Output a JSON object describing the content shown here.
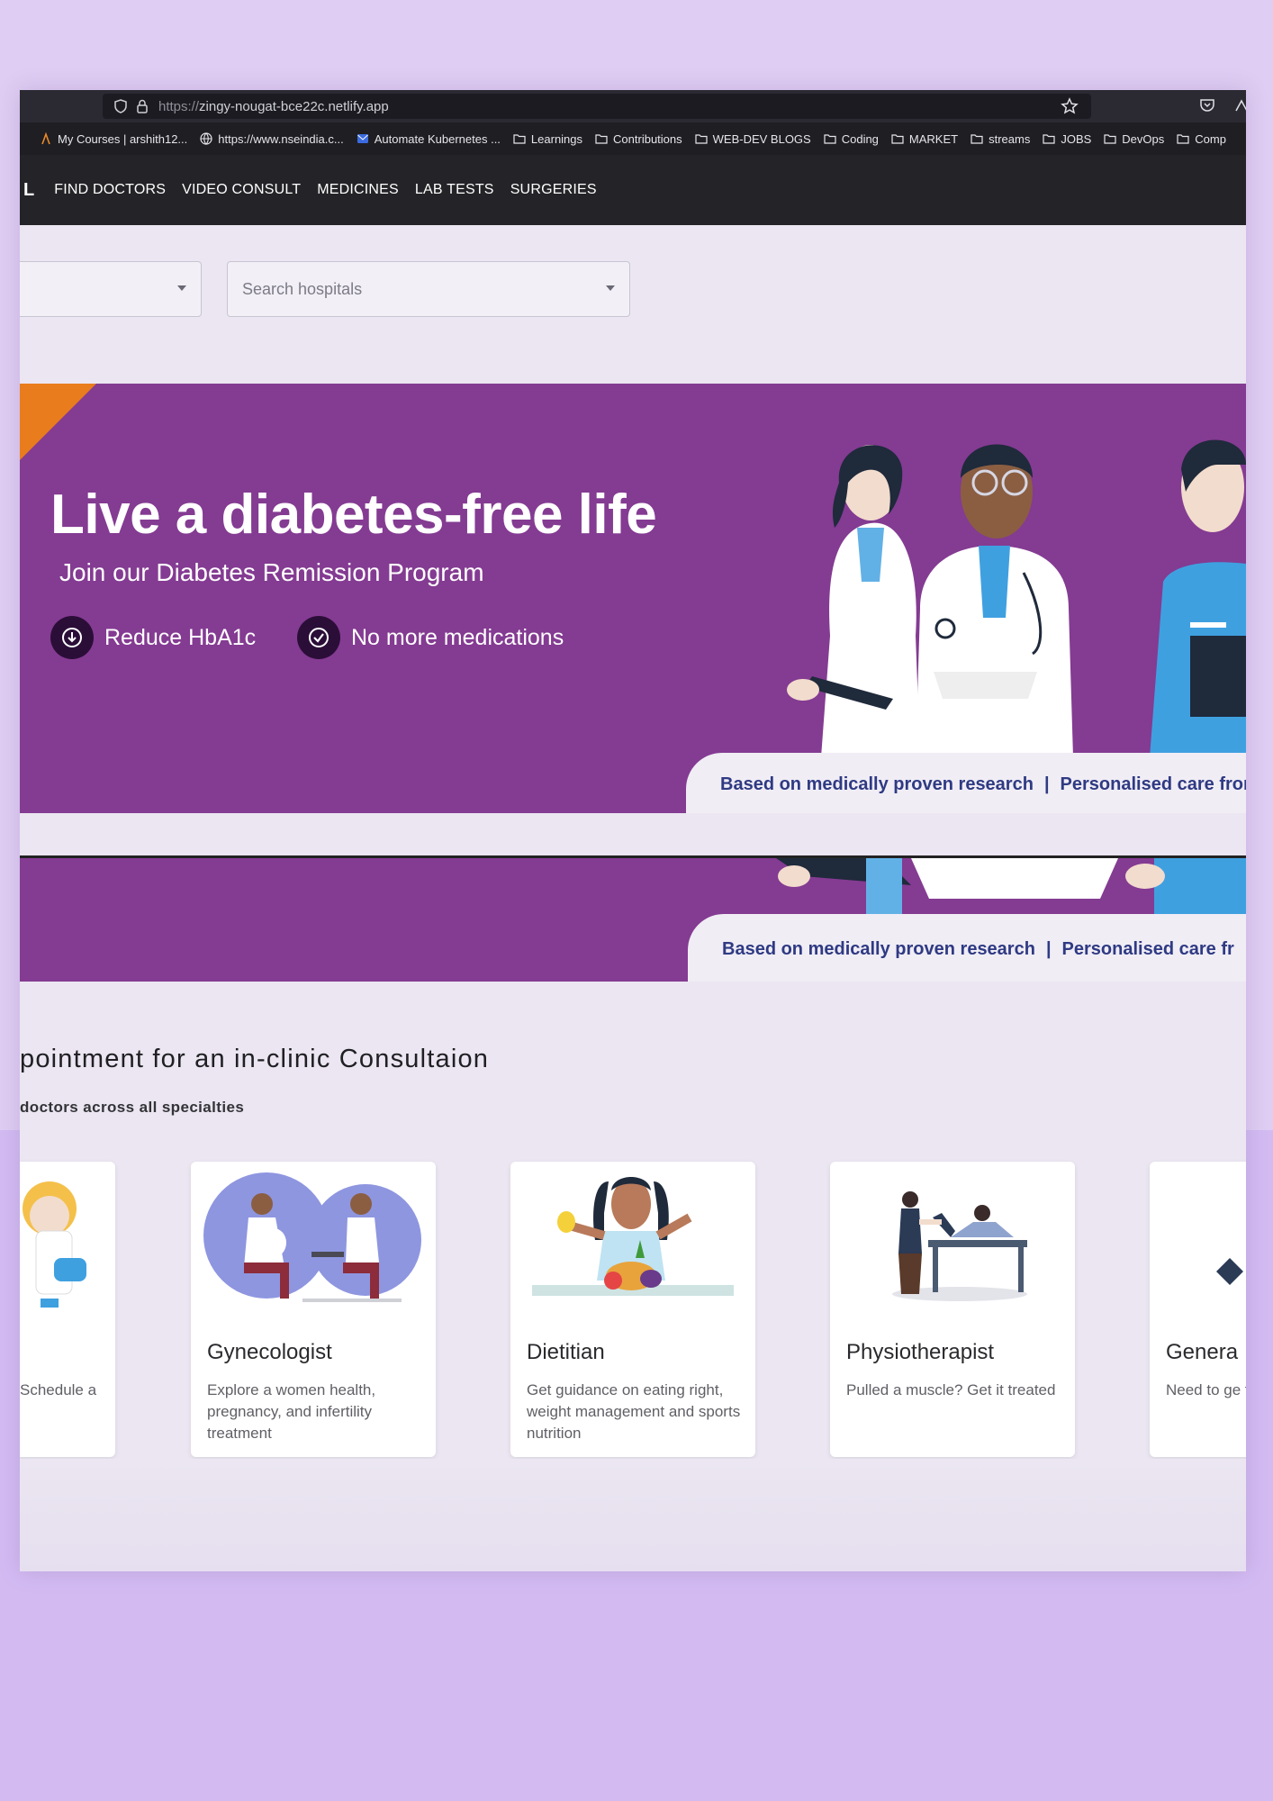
{
  "browser": {
    "url_prefix": "https://",
    "url_host": "zingy-nougat-bce22c.netlify.app",
    "bookmarks": [
      {
        "icon": "person-icon",
        "label": "My Courses | arshith12..."
      },
      {
        "icon": "globe-icon",
        "label": "https://www.nseindia.c..."
      },
      {
        "icon": "mail-icon",
        "label": "Automate Kubernetes ..."
      },
      {
        "icon": "folder-icon",
        "label": "Learnings"
      },
      {
        "icon": "folder-icon",
        "label": "Contributions"
      },
      {
        "icon": "folder-icon",
        "label": "WEB-DEV BLOGS"
      },
      {
        "icon": "folder-icon",
        "label": "Coding"
      },
      {
        "icon": "folder-icon",
        "label": "MARKET"
      },
      {
        "icon": "folder-icon",
        "label": "streams"
      },
      {
        "icon": "folder-icon",
        "label": "JOBS"
      },
      {
        "icon": "folder-icon",
        "label": "DevOps"
      },
      {
        "icon": "folder-icon",
        "label": "Comp"
      }
    ]
  },
  "nav": {
    "logo_fragment": "L",
    "items": [
      "FIND DOCTORS",
      "VIDEO CONSULT",
      "MEDICINES",
      "LAB TESTS",
      "SURGERIES"
    ]
  },
  "search": {
    "location_value": "",
    "hospital_placeholder": "Search hospitals"
  },
  "banner": {
    "title": "Live a diabetes-free life",
    "subtitle": "Join our Diabetes Remission Program",
    "features": [
      "Reduce HbA1c",
      "No more medications"
    ],
    "pill_left": "Based on medically proven research",
    "pill_sep": "|",
    "pill_right": "Personalised care from an",
    "strip_pill_left": "Based on medically proven research",
    "strip_pill_right": "Personalised care fr",
    "colors": {
      "purple": "#843b92",
      "orange": "#e97c1d",
      "navy": "#2f3a83"
    }
  },
  "consult": {
    "title": "pointment for an in-clinic Consultaion",
    "subtitle": "doctors across all specialties",
    "cards": [
      {
        "title": "",
        "desc": "Schedule a"
      },
      {
        "title": "Gynecologist",
        "desc": "Explore a women health, pregnancy, and infertility treatment"
      },
      {
        "title": "Dietitian",
        "desc": "Get guidance on eating right, weight management and sports nutrition"
      },
      {
        "title": "Physiotherapist",
        "desc": "Pulled a muscle? Get it treated"
      },
      {
        "title": "Genera",
        "desc": "Need to ge the right su"
      }
    ]
  }
}
